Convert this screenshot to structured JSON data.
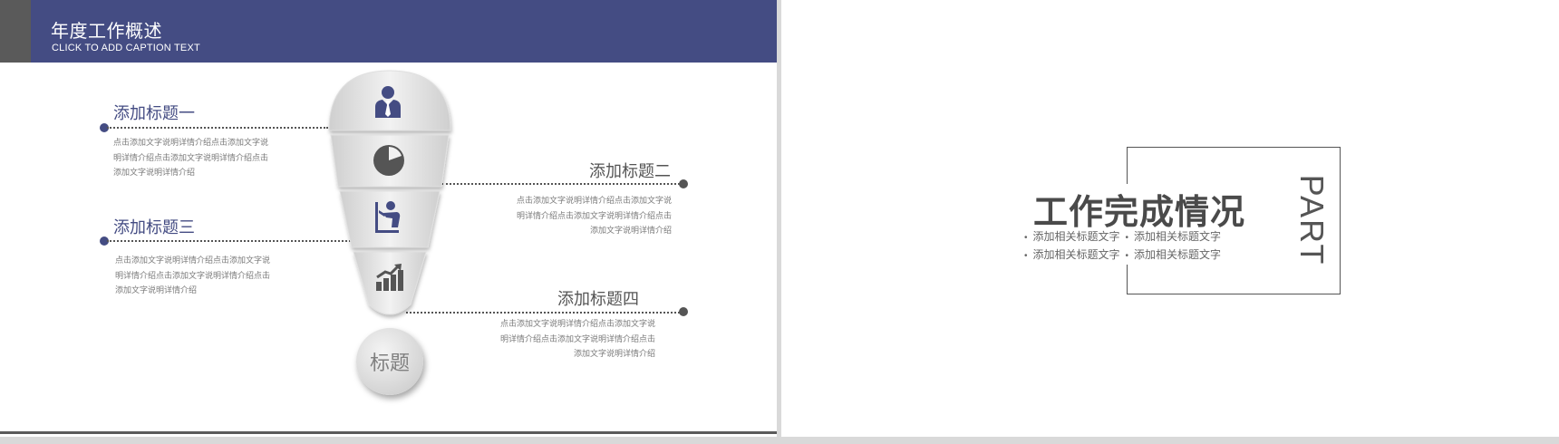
{
  "left_slide": {
    "header": {
      "title": "年度工作概述",
      "subtitle": "CLICK TO ADD CAPTION TEXT"
    },
    "items": [
      {
        "title": "添加标题一",
        "desc": [
          "点击添加文字说明详情介绍点击添加文字说",
          "明详情介绍点击添加文字说明详情介绍点击",
          "添加文字说明详情介绍"
        ]
      },
      {
        "title": "添加标题二",
        "desc": [
          "点击添加文字说明详情介绍点击添加文字说",
          "明详情介绍点击添加文字说明详情介绍点击",
          "添加文字说明详情介绍"
        ]
      },
      {
        "title": "添加标题三",
        "desc": [
          "点击添加文字说明详情介绍点击添加文字说",
          "明详情介绍点击添加文字说明详情介绍点击",
          "添加文字说明详情介绍"
        ]
      },
      {
        "title": "添加标题四",
        "desc": [
          "点击添加文字说明详情介绍点击添加文字说",
          "明详情介绍点击添加文字说明详情介绍点击",
          "添加文字说明详情介绍"
        ]
      }
    ],
    "icons": [
      "businessman-icon",
      "pie-chart-icon",
      "presenter-icon",
      "growth-chart-icon"
    ],
    "circle_label": "标题",
    "colors": {
      "accent": "#444c83",
      "dark_gray": "#555555"
    }
  },
  "right_slide": {
    "title": "工作完成情况",
    "part_label": "PART",
    "bullets": [
      [
        "添加相关标题文字",
        "添加相关标题文字"
      ],
      [
        "添加相关标题文字",
        "添加相关标题文字"
      ]
    ]
  }
}
